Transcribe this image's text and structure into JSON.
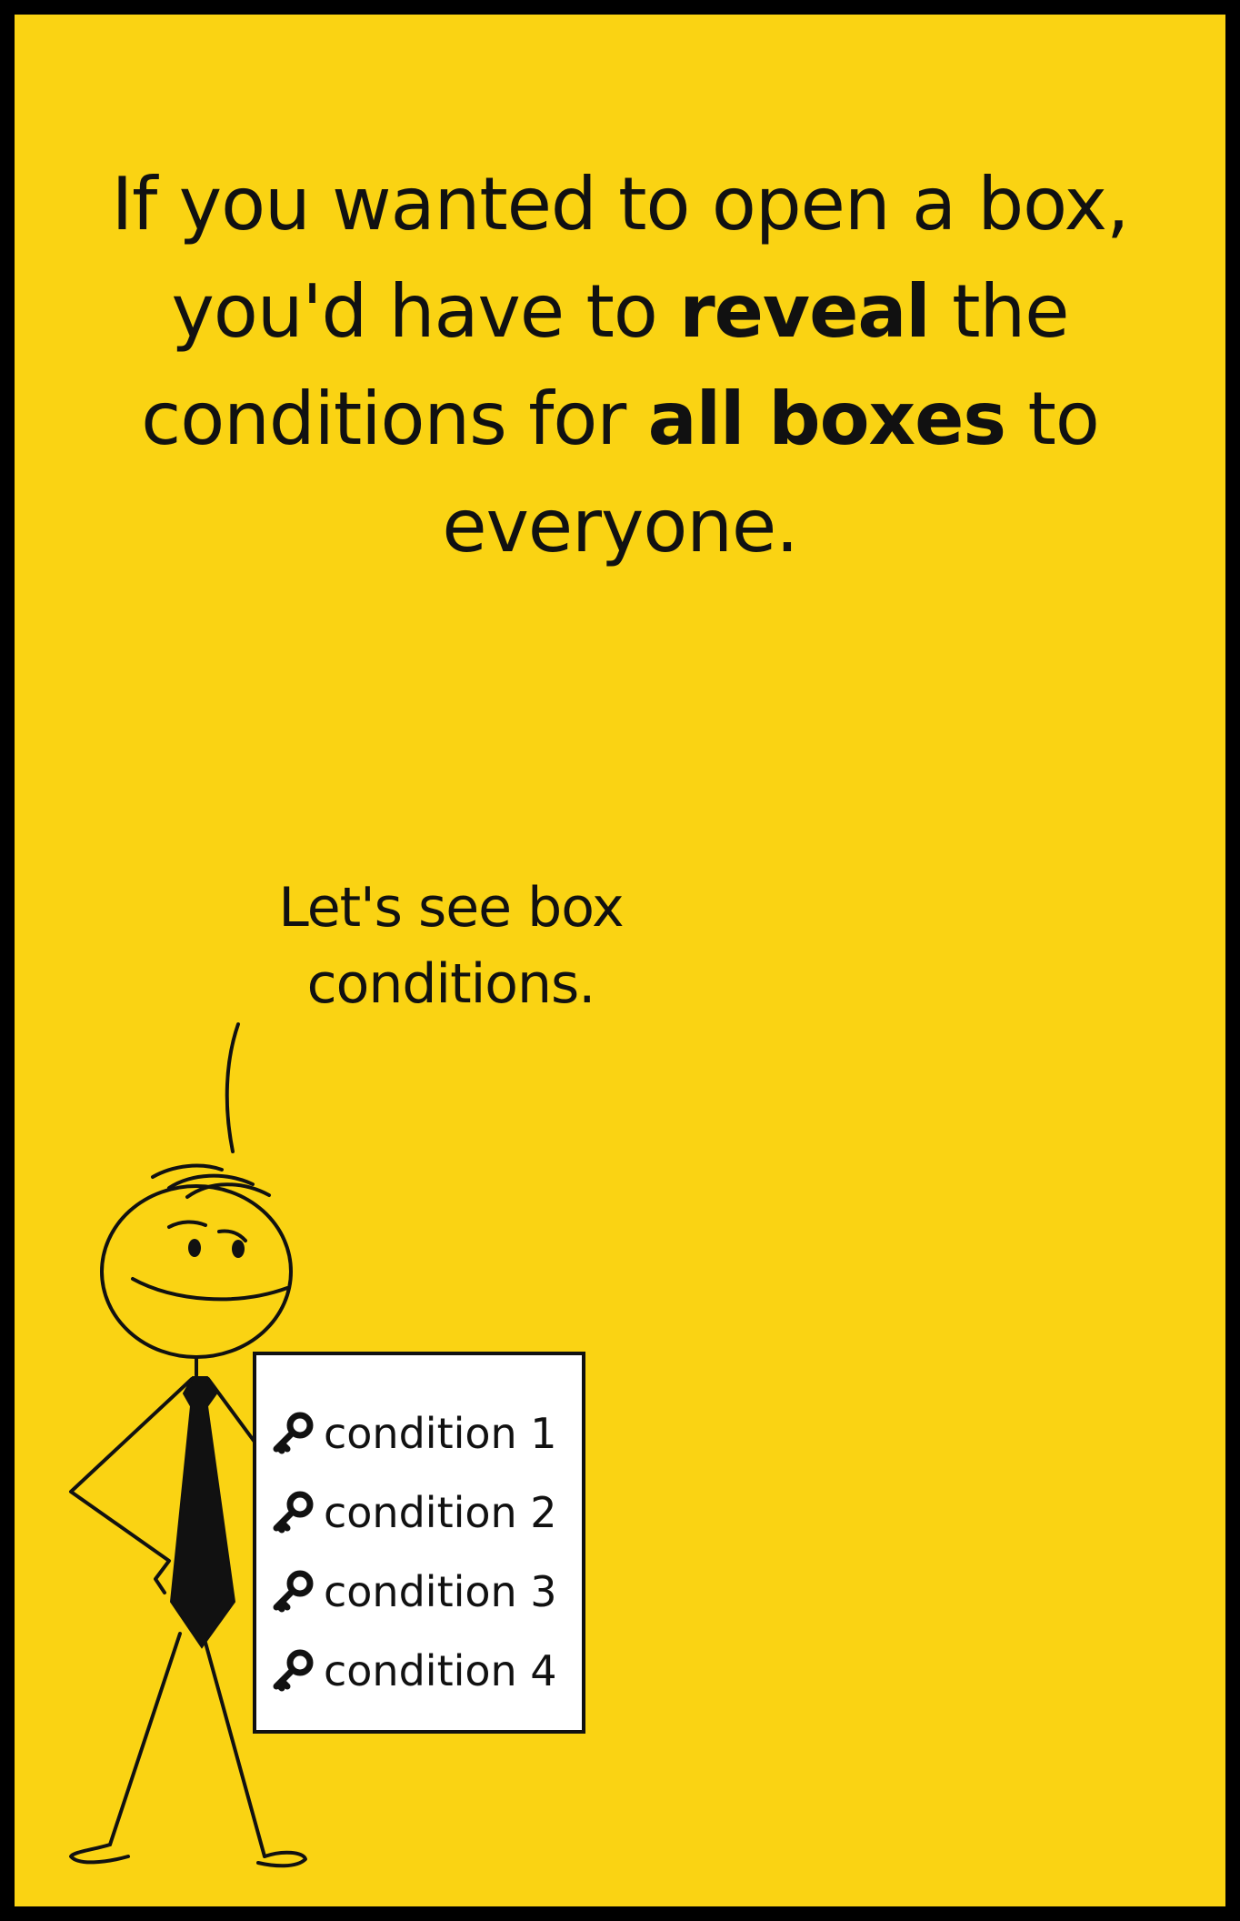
{
  "headline": {
    "part1": "If you wanted to open a box, you'd have to ",
    "bold1": "reveal",
    "part2": " the conditions for ",
    "bold2": "all boxes",
    "part3": " to everyone."
  },
  "speech": {
    "line1": "Let's see box",
    "line2": "conditions."
  },
  "sign": {
    "conditions": [
      {
        "icon": "key-icon",
        "label": "condition 1"
      },
      {
        "icon": "key-icon",
        "label": "condition 2"
      },
      {
        "icon": "key-icon",
        "label": "condition 3"
      },
      {
        "icon": "key-icon",
        "label": "condition 4"
      }
    ]
  },
  "colors": {
    "background": "#FAD313",
    "frame": "#000000",
    "ink": "#111111",
    "sign": "#FFFFFF"
  }
}
